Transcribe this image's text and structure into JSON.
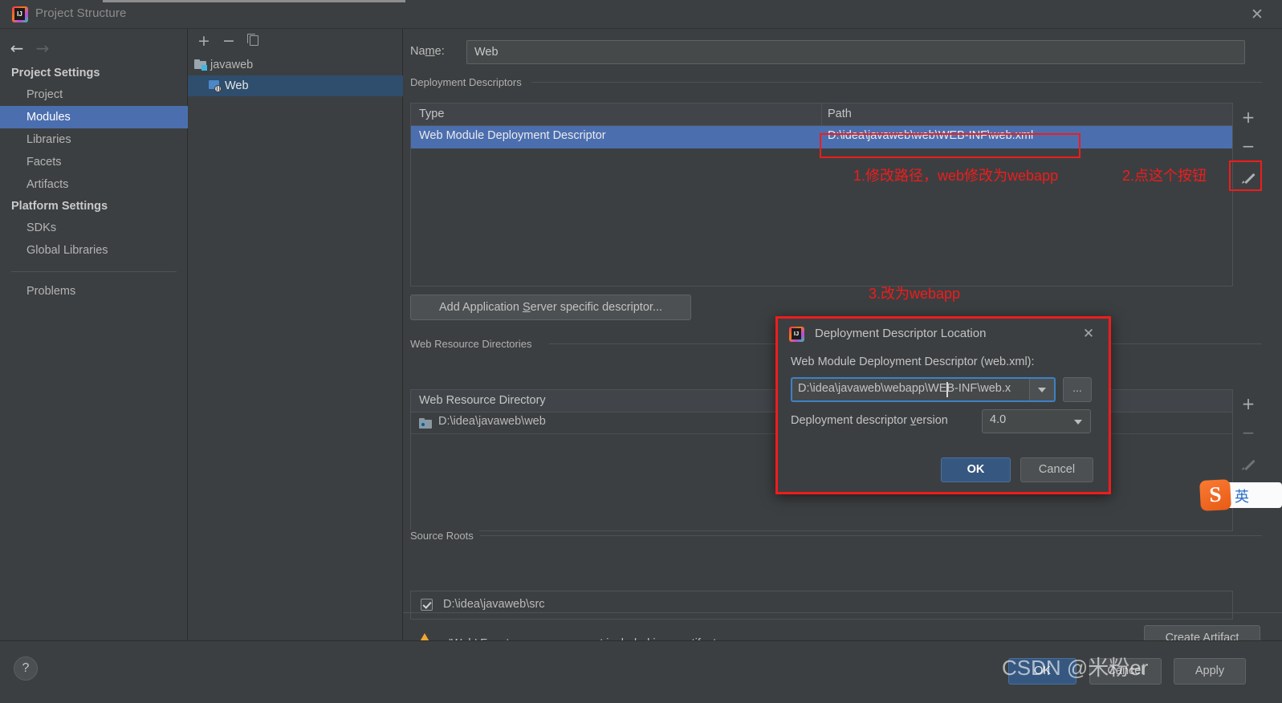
{
  "window": {
    "title": "Project Structure",
    "close_label": "✕",
    "logo_icon": "intellij-logo-icon"
  },
  "sidebar": {
    "back_icon": "arrow-left-icon",
    "forward_icon": "arrow-right-icon",
    "groups": [
      {
        "label": "Project Settings",
        "items": [
          {
            "label": "Project",
            "selected": false
          },
          {
            "label": "Modules",
            "selected": true
          },
          {
            "label": "Libraries",
            "selected": false
          },
          {
            "label": "Facets",
            "selected": false
          },
          {
            "label": "Artifacts",
            "selected": false
          }
        ]
      },
      {
        "label": "Platform Settings",
        "items": [
          {
            "label": "SDKs",
            "selected": false
          },
          {
            "label": "Global Libraries",
            "selected": false
          }
        ]
      }
    ],
    "problems_label": "Problems"
  },
  "module_panel": {
    "toolbar": {
      "add_label": "+",
      "remove_label": "−",
      "copy_icon": "copy-icon"
    },
    "tree": [
      {
        "label": "javaweb",
        "icon": "project-folder-icon",
        "selected": false
      },
      {
        "label": "Web",
        "icon": "web-module-icon",
        "selected": true
      }
    ]
  },
  "main": {
    "name_label_pre": "Na",
    "name_label_key": "m",
    "name_label_post": "e:",
    "name_value": "Web",
    "deployment_descriptors": {
      "section_label": "Deployment Descriptors",
      "columns": [
        "Type",
        "Path"
      ],
      "rows": [
        {
          "type": "Web Module Deployment Descriptor",
          "path": "D:\\idea\\javaweb\\web\\WEB-INF\\web.xml",
          "selected": true
        }
      ],
      "tools": {
        "add": "+",
        "remove": "−",
        "edit_icon": "pencil-icon"
      }
    },
    "add_app_server_button": {
      "pre": "Add Application ",
      "key": "S",
      "post": "erver specific descriptor..."
    },
    "web_resource_directories": {
      "section_label": "Web Resource Directories",
      "columns": [
        "Web Resource Directory"
      ],
      "rows": [
        {
          "path": "D:\\idea\\javaweb\\web",
          "icon": "web-dir-icon"
        }
      ],
      "tools": {
        "add": "+",
        "remove": "−",
        "edit_icon": "pencil-icon",
        "help": "?"
      }
    },
    "source_roots": {
      "section_label": "Source Roots",
      "rows": [
        {
          "path": "D:\\idea\\javaweb\\src",
          "checked": true
        }
      ]
    },
    "warning": {
      "icon": "warning-triangle-icon",
      "text": "'Web' Facet resources are not included in an artifact"
    },
    "create_artifact_button": {
      "pre": "Create Arti",
      "key": "f",
      "post": "act"
    }
  },
  "bottom_bar": {
    "help_label": "?",
    "ok_label": "OK",
    "cancel_label": "Cancel",
    "apply_label": "Apply"
  },
  "modal": {
    "title": "Deployment Descriptor Location",
    "close_label": "✕",
    "logo_icon": "intellij-logo-icon",
    "field_label": "Web Module Deployment Descriptor (web.xml):",
    "path_value": "D:\\idea\\javaweb\\webapp\\WEB-INF\\web.x",
    "browse_label": "...",
    "version_label_pre": "Deployment descriptor ",
    "version_label_key": "v",
    "version_label_post": "ersion",
    "version_value": "4.0",
    "ok_label": "OK",
    "cancel_label": "Cancel"
  },
  "annotations": [
    {
      "id": "anno-1",
      "text": "1.修改路径，web修改为webapp"
    },
    {
      "id": "anno-2",
      "text": "2.点这个按钮"
    },
    {
      "id": "anno-3",
      "text": "3.改为webapp"
    }
  ],
  "ime": {
    "badge": "S",
    "mode": "英"
  },
  "watermark": "CSDN @米粉er",
  "colors": {
    "background": "#3c3f41",
    "selection_blue": "#4b6eaf",
    "tree_selection": "#2f4d6d",
    "annotation_red": "#f01c1c",
    "ok_button": "#365880",
    "warning_amber": "#f0a732",
    "focus_border": "#3d81c6"
  }
}
